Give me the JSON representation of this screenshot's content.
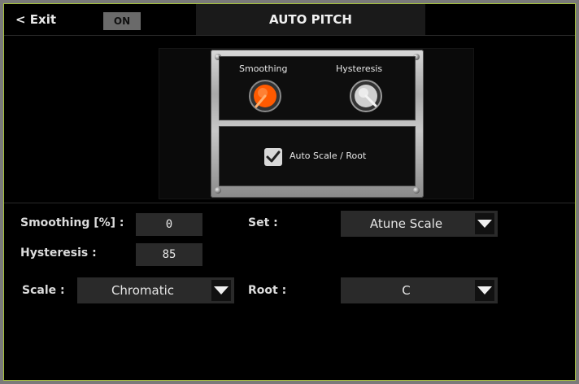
{
  "header": {
    "exit_label": "< Exit",
    "on_label": "ON",
    "title": "AUTO PITCH"
  },
  "panel": {
    "knob_smoothing_label": "Smoothing",
    "knob_hysteresis_label": "Hysteresis",
    "checkbox_label": "Auto Scale / Root",
    "checkbox_checked": true,
    "knob_smoothing_color": "#ff5a00",
    "knob_hysteresis_color": "#d0d0d0"
  },
  "params": {
    "smoothing_label": "Smoothing [%] :",
    "smoothing_value": "0",
    "hysteresis_label": "Hysteresis :",
    "hysteresis_value": "85",
    "scale_label": "Scale :",
    "scale_value": "Chromatic",
    "set_label": "Set :",
    "set_value": "Atune Scale",
    "root_label": "Root :",
    "root_value": "C"
  },
  "colors": {
    "border_accent": "#a7c43a",
    "field_bg": "#2a2a2a"
  }
}
